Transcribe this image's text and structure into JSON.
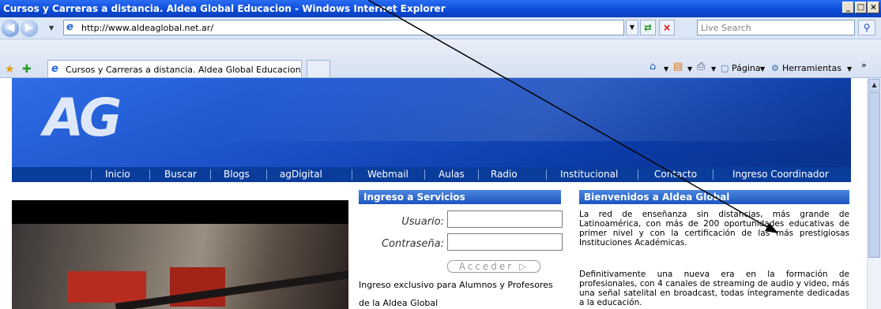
{
  "window": {
    "title": "Cursos y Carreras a distancia. Aldea Global Educacion - Windows Internet Explorer",
    "buttons": [
      "_",
      "Ή",
      "X"
    ]
  },
  "address_bar": {
    "url": "http://www.aldeaglobal.net.ar/",
    "search_placeholder": "Live Search"
  },
  "tabs": [
    {
      "label": "Cursos y Carreras a distancia. Aldea Global Educacion"
    }
  ],
  "toolbar": {
    "page_label": "Página",
    "tools_label": "Herramientas"
  },
  "banner": {
    "logo_text": "AG",
    "menu": [
      "Inicio",
      "Buscar",
      "Blogs",
      "agDigital",
      "Webmail",
      "Aulas",
      "Radio",
      "Institucional",
      "Contacto",
      "Ingreso Coordinador"
    ]
  },
  "login": {
    "title": "Ingreso a Servicios",
    "user_label": "Usuario:",
    "pass_label": "Contraseña:",
    "submit_label": "Acceder",
    "note_line1": "Ingreso exclusivo para Alumnos y Profesores",
    "note_line2": "de la Aldea Global"
  },
  "welcome": {
    "title": "Bienvenidos a Aldea Global",
    "p1": "La red de enseñanza sin distancias, más grande de Latinoamérica, con más de 200 oportunidades educativas de primer nivel y con la certificación de las más prestigiosas Instituciones Académicas.",
    "p2": "Definitivamente una nueva era en la formación de profesionales, con 4 canales de streaming de audio y video, más una señal satelital en broadcast, todas íntegramente dedicadas a la educación."
  },
  "colors": {
    "title_bar": "#0a4ad8",
    "banner": "#1d55cc",
    "menu_bar": "#0a3c9c"
  }
}
